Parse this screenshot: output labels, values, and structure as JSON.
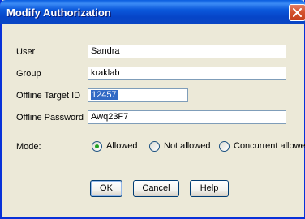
{
  "window": {
    "title": "Modify Authorization"
  },
  "form": {
    "user": {
      "label": "User",
      "value": "Sandra"
    },
    "group": {
      "label": "Group",
      "value": "kraklab"
    },
    "offline_target_id": {
      "label": "Offline Target ID",
      "value": "12457"
    },
    "offline_password": {
      "label": "Offline Password",
      "value": "Awq23F7"
    },
    "mode": {
      "label": "Mode:",
      "options": [
        "Allowed",
        "Not allowed",
        "Concurrent allowed"
      ],
      "selected": "Allowed"
    }
  },
  "buttons": {
    "ok": "OK",
    "cancel": "Cancel",
    "help": "Help"
  },
  "colors": {
    "title_bar": "#0a5ddf",
    "dialog_bg": "#ece9d8",
    "close_button": "#d4532f",
    "selection": "#316ac5",
    "radio_selected": "#21a121"
  },
  "icons": {
    "close": "close-icon"
  }
}
